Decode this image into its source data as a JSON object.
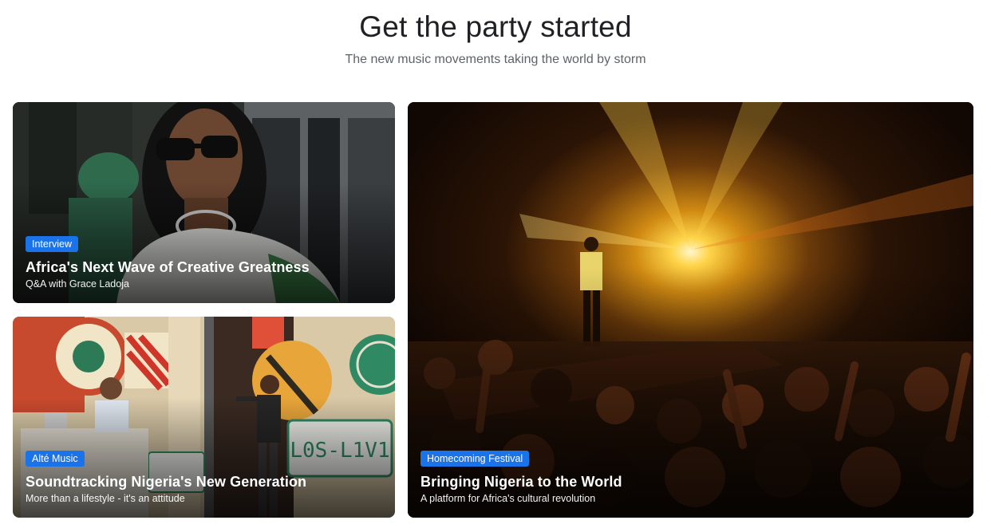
{
  "header": {
    "title": "Get the party started",
    "subtitle": "The new music movements taking the world by storm"
  },
  "cards": [
    {
      "badge": "Interview",
      "title": "Africa's Next Wave of Creative Greatness",
      "subtitle": "Q&A with Grace Ladoja"
    },
    {
      "badge": "Alté Music",
      "title": "Soundtracking Nigeria's New Generation",
      "subtitle": "More than a lifestyle - it's an attitude"
    },
    {
      "badge": "Homecoming Festival",
      "title": "Bringing Nigeria to the World",
      "subtitle": "A platform for Africa's cultural revolution"
    }
  ],
  "images": {
    "card1": "portrait-photo",
    "card2": "stage-performance-photo",
    "card3": "concert-crowd-photo"
  },
  "colors": {
    "badge": "#1a73e8",
    "title": "#202124",
    "subtitle": "#5f6368"
  }
}
